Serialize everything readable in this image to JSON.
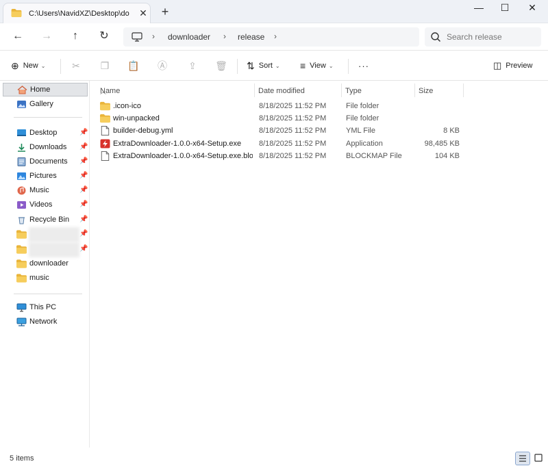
{
  "tab": {
    "title": "C:\\Users\\NavidXZ\\Desktop\\do",
    "close": "✕",
    "new_tab": "+"
  },
  "window": {
    "minimize": "—",
    "maximize": "☐",
    "close": "✕"
  },
  "nav": {
    "back": "←",
    "forward": "→",
    "up": "↑",
    "refresh": "↻"
  },
  "breadcrumb": {
    "items": [
      "downloader",
      "release"
    ],
    "sep": "›"
  },
  "search": {
    "placeholder": "Search release"
  },
  "toolbar": {
    "new_label": "New",
    "sort_label": "Sort",
    "view_label": "View",
    "more_label": "···",
    "preview_label": "Preview"
  },
  "columns": {
    "name": "Name",
    "date": "Date modified",
    "type": "Type",
    "size": "Size"
  },
  "sidebar": {
    "home": "Home",
    "gallery": "Gallery",
    "desktop": "Desktop",
    "downloads": "Downloads",
    "documents": "Documents",
    "pictures": "Pictures",
    "music": "Music",
    "videos": "Videos",
    "recycle": "Recycle Bin",
    "downloader": "downloader",
    "music_folder": "music",
    "thispc": "This PC",
    "network": "Network"
  },
  "files": [
    {
      "name": ".icon-ico",
      "date": "8/18/2025 11:52 PM",
      "type": "File folder",
      "size": ""
    },
    {
      "name": "win-unpacked",
      "date": "8/18/2025 11:52 PM",
      "type": "File folder",
      "size": ""
    },
    {
      "name": "builder-debug.yml",
      "date": "8/18/2025 11:52 PM",
      "type": "YML File",
      "size": "8 KB"
    },
    {
      "name": "ExtraDownloader-1.0.0-x64-Setup.exe",
      "date": "8/18/2025 11:52 PM",
      "type": "Application",
      "size": "98,485 KB"
    },
    {
      "name": "ExtraDownloader-1.0.0-x64-Setup.exe.blo...",
      "date": "8/18/2025 11:52 PM",
      "type": "BLOCKMAP File",
      "size": "104 KB"
    }
  ],
  "status": {
    "count": "5 items"
  },
  "colors": {
    "folder": "#f3c24e",
    "accent": "#3b73c4",
    "app_red": "#d8322b"
  }
}
